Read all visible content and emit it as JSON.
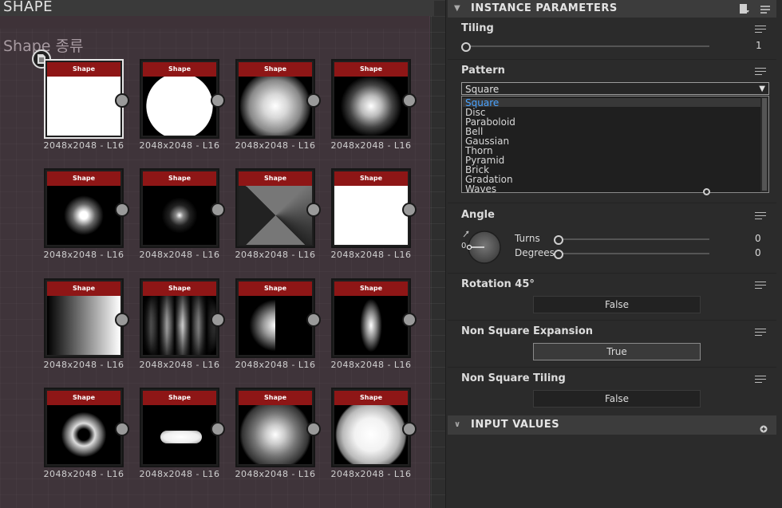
{
  "graph": {
    "frame_title": "SHAPE",
    "frame_comment": "Shape 종류",
    "node_header": "Shape",
    "nodes": [
      {
        "label": "2048x2048 - L16",
        "thumb": "square"
      },
      {
        "label": "2048x2048 - L16",
        "thumb": "disc"
      },
      {
        "label": "2048x2048 - L16",
        "thumb": "paraboloid"
      },
      {
        "label": "2048x2048 - L16",
        "thumb": "bell"
      },
      {
        "label": "2048x2048 - L16",
        "thumb": "gaussian"
      },
      {
        "label": "2048x2048 - L16",
        "thumb": "thorn"
      },
      {
        "label": "2048x2048 - L16",
        "thumb": "pyramid"
      },
      {
        "label": "2048x2048 - L16",
        "thumb": "brick"
      },
      {
        "label": "2048x2048 - L16",
        "thumb": "gradation"
      },
      {
        "label": "2048x2048 - L16",
        "thumb": "waves"
      },
      {
        "label": "2048x2048 - L16",
        "thumb": "half-bell"
      },
      {
        "label": "2048x2048 - L16",
        "thumb": "ridged-bell"
      },
      {
        "label": "2048x2048 - L16",
        "thumb": "crescent"
      },
      {
        "label": "2048x2048 - L16",
        "thumb": "capsule"
      },
      {
        "label": "2048x2048 - L16",
        "thumb": "cone"
      },
      {
        "label": "2048x2048 - L16",
        "thumb": "hemisphere"
      }
    ]
  },
  "panel": {
    "instance_header": "INSTANCE PARAMETERS",
    "input_header": "INPUT VALUES",
    "tiling": {
      "label": "Tiling",
      "value": "1"
    },
    "pattern": {
      "label": "Pattern",
      "selected": "Square",
      "options": [
        "Square",
        "Disc",
        "Paraboloid",
        "Bell",
        "Gaussian",
        "Thorn",
        "Pyramid",
        "Brick",
        "Gradation",
        "Waves"
      ]
    },
    "angle": {
      "label": "Angle",
      "dial_value": "0",
      "turns_label": "Turns",
      "turns_value": "0",
      "degrees_label": "Degrees",
      "degrees_value": "0"
    },
    "rotation45": {
      "label": "Rotation 45°",
      "value": "False"
    },
    "non_square_expansion": {
      "label": "Non Square Expansion",
      "value": "True"
    },
    "non_square_tiling": {
      "label": "Non Square Tiling",
      "value": "False"
    }
  },
  "colors": {
    "node_header": "#8e1616",
    "selected_option": "#4aa3ff",
    "panel_bg": "#2b2b2b"
  }
}
